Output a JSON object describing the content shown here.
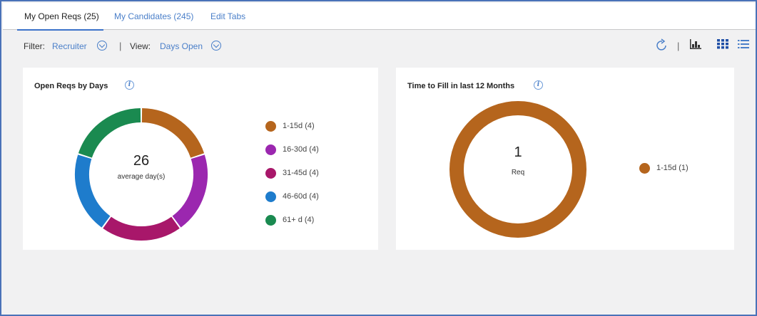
{
  "tabs": [
    {
      "label": "My Open Reqs (25)",
      "active": true
    },
    {
      "label": "My Candidates (245)",
      "active": false
    },
    {
      "label": "Edit Tabs",
      "active": false
    }
  ],
  "filterbar": {
    "filter_label": "Filter:",
    "filter_value": "Recruiter",
    "separator": "|",
    "view_label": "View:",
    "view_value": "Days Open",
    "tools": [
      "refresh-icon",
      "bar-chart-icon",
      "grid-view-icon",
      "list-view-icon"
    ]
  },
  "colors": {
    "accent": "#4a7fc9",
    "seg1": "#b5651d",
    "seg2": "#9b27af",
    "seg3": "#a8176a",
    "seg4": "#1e7ccc",
    "seg5": "#1a8a50"
  },
  "chart_data": [
    {
      "type": "pie",
      "title": "Open Reqs by Days",
      "center_value": "26",
      "center_label": "average day(s)",
      "categories": [
        "1-15d (4)",
        "16-30d (4)",
        "31-45d (4)",
        "46-60d (4)",
        "61+ d (4)"
      ],
      "values": [
        4,
        4,
        4,
        4,
        4
      ],
      "segment_colors": [
        "#b5651d",
        "#9b27af",
        "#a8176a",
        "#1e7ccc",
        "#1a8a50"
      ],
      "legend": "right"
    },
    {
      "type": "pie",
      "title": "Time to Fill in last 12 Months",
      "center_value": "1",
      "center_label": "Req",
      "categories": [
        "1-15d (1)"
      ],
      "values": [
        1
      ],
      "segment_colors": [
        "#b5651d"
      ],
      "legend": "right"
    }
  ]
}
